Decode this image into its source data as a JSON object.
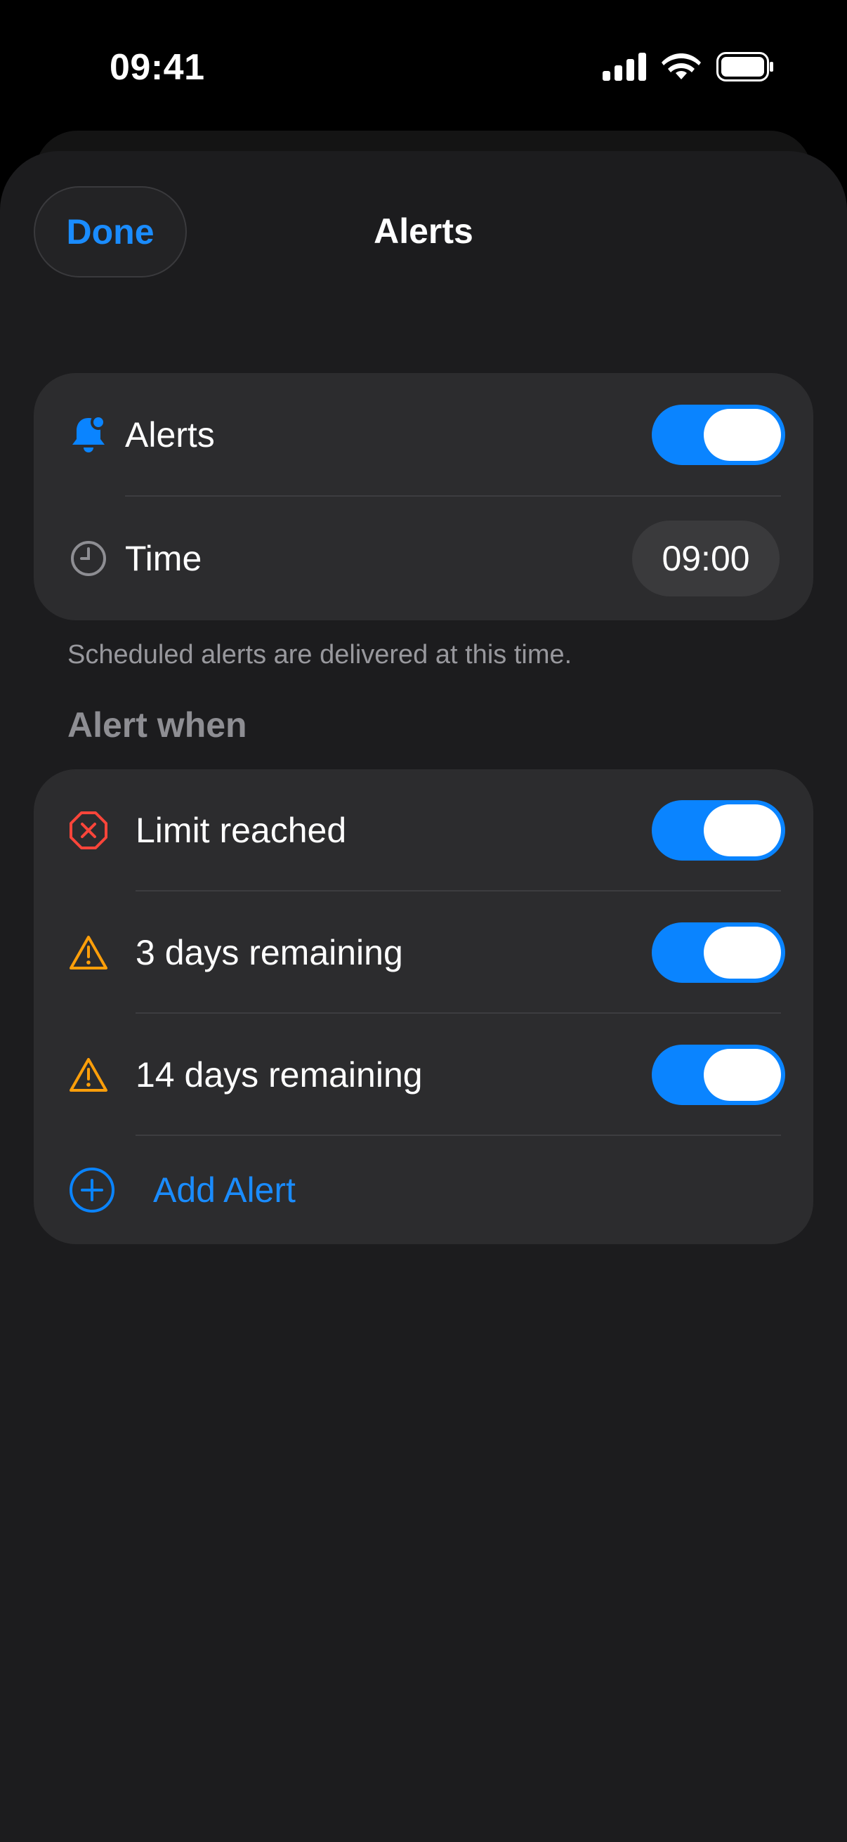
{
  "status_bar": {
    "time": "09:41",
    "icons": [
      "cellular-signal-icon",
      "wifi-icon",
      "battery-icon"
    ]
  },
  "header": {
    "done_label": "Done",
    "title": "Alerts"
  },
  "settings_group": {
    "alerts_row": {
      "icon": "bell-badge-icon",
      "label": "Alerts",
      "enabled": true
    },
    "time_row": {
      "icon": "clock-icon",
      "label": "Time",
      "value": "09:00"
    },
    "footnote": "Scheduled alerts are delivered at this time."
  },
  "alert_when": {
    "header": "Alert when",
    "items": [
      {
        "icon": "x-octagon-icon",
        "label": "Limit reached",
        "enabled": true
      },
      {
        "icon": "warning-triangle-icon",
        "label": "3 days remaining",
        "enabled": true
      },
      {
        "icon": "warning-triangle-icon",
        "label": "14 days remaining",
        "enabled": true
      }
    ],
    "add_label": "Add Alert",
    "add_icon": "plus-circle-icon"
  },
  "colors": {
    "accent": "#0a84ff",
    "link": "#1a8cff",
    "danger": "#ff453a",
    "warning": "#ff9f0a",
    "sheet_bg": "#1c1c1e",
    "group_bg": "#2c2c2e"
  }
}
